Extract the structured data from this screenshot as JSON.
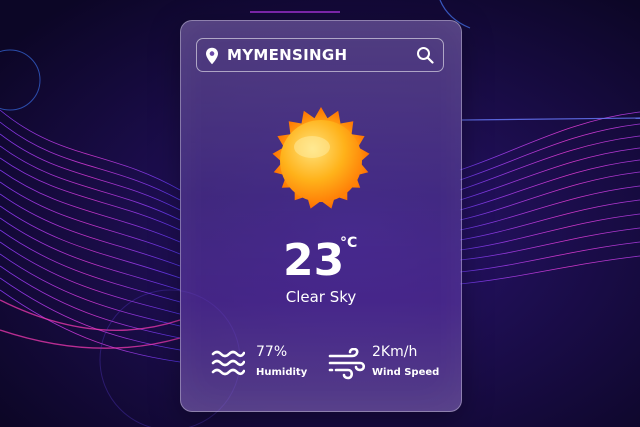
{
  "search": {
    "city": "MYMENSINGH",
    "location_icon": "location-pin-icon",
    "search_icon": "search-icon"
  },
  "weather": {
    "icon": "sun-icon",
    "temperature": "23",
    "unit": "°C",
    "condition": "Clear Sky"
  },
  "humidity": {
    "value": "77%",
    "label": "Humidity",
    "icon": "humidity-waves-icon"
  },
  "wind": {
    "value": "2Km/h",
    "label": "Wind Speed",
    "icon": "wind-icon"
  },
  "colors": {
    "background": "#130a35",
    "wave_pink": "#e23bd9",
    "wave_violet": "#7b3bf0",
    "sun_orange": "#ff8a0a",
    "sun_yellow": "#ffd24a"
  }
}
